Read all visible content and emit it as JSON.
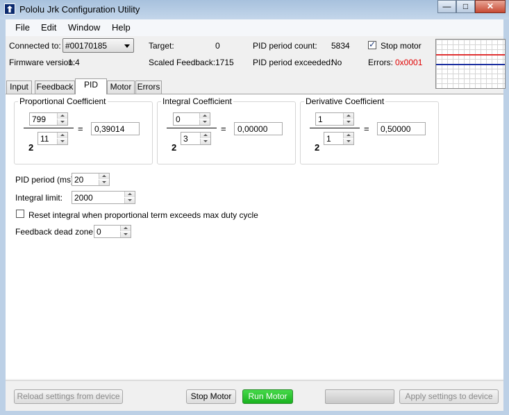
{
  "window": {
    "title": "Pololu Jrk Configuration Utility",
    "minimize": "—",
    "maximize": "□",
    "close": "✕"
  },
  "menu": [
    "File",
    "Edit",
    "Window",
    "Help"
  ],
  "status": {
    "connected_label": "Connected to:",
    "connected_value": "#00170185",
    "firmware_label": "Firmware version:",
    "firmware_value": "1.4",
    "target_label": "Target:",
    "target_value": "0",
    "scaled_label": "Scaled Feedback:",
    "scaled_value": "1715",
    "pid_count_label": "PID period count:",
    "pid_count_value": "5834",
    "pid_exceeded_label": "PID period exceeded:",
    "pid_exceeded_value": "No",
    "stop_motor_label": "Stop motor",
    "stop_motor_checked": true,
    "errors_label": "Errors:",
    "errors_value": "0x0001",
    "errors_color": "#e00000"
  },
  "graph": {
    "line1_color": "#e03030",
    "line2_color": "#1a2fa0"
  },
  "tabs": [
    "Input",
    "Feedback",
    "PID",
    "Motor",
    "Errors"
  ],
  "active_tab": "PID",
  "coefficients": {
    "proportional": {
      "title": "Proportional Coefficient",
      "multiplier": "799",
      "exponent": "11",
      "base": "2",
      "result": "0,39014"
    },
    "integral": {
      "title": "Integral Coefficient",
      "multiplier": "0",
      "exponent": "3",
      "base": "2",
      "result": "0,00000"
    },
    "derivative": {
      "title": "Derivative Coefficient",
      "multiplier": "1",
      "exponent": "1",
      "base": "2",
      "result": "0,50000"
    },
    "equals": "="
  },
  "settings": {
    "pid_period_label": "PID period (ms):",
    "pid_period_value": "20",
    "integral_limit_label": "Integral limit:",
    "integral_limit_value": "2000",
    "reset_integral_label": "Reset integral when proportional term exceeds max duty cycle",
    "dead_zone_label": "Feedback dead zone:",
    "dead_zone_value": "0"
  },
  "buttons": {
    "reload": "Reload settings from device",
    "stop": "Stop Motor",
    "run": "Run Motor",
    "apply": "Apply settings to device"
  }
}
